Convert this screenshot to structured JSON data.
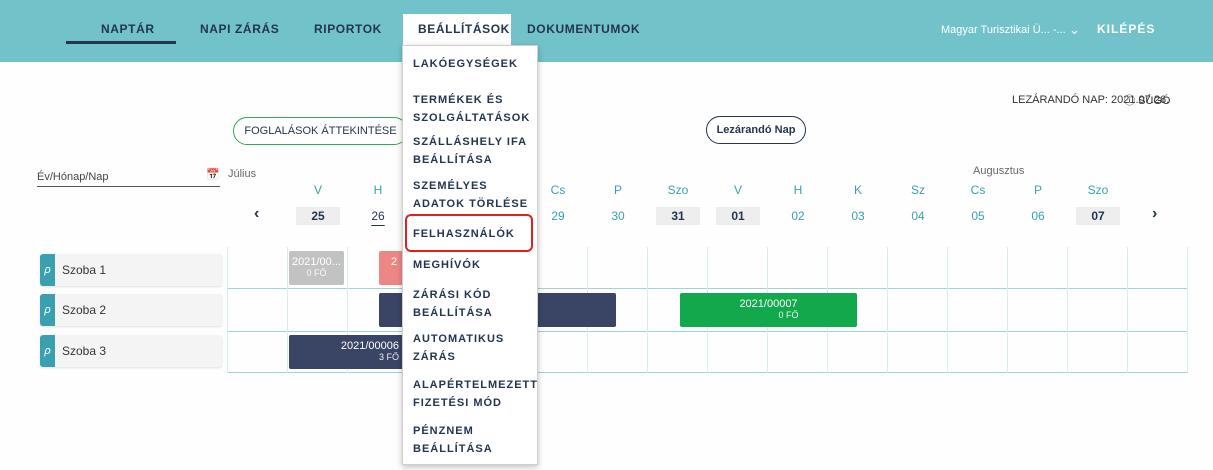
{
  "nav": {
    "items": [
      {
        "label": "NAPTÁR"
      },
      {
        "label": "NAPI ZÁRÁS"
      },
      {
        "label": "RIPORTOK"
      },
      {
        "label": "BEÁLLÍTÁSOK"
      },
      {
        "label": "DOKUMENTUMOK"
      }
    ],
    "user_label": "Magyar Turisztikai Ü... -...",
    "logout_label": "KILÉPÉS"
  },
  "header": {
    "closing_day_label": "LEZÁRANDÓ NAP: 2021.07.26.",
    "help_label": "SÚGÓ"
  },
  "buttons": {
    "overview_label": "FOGLALÁSOK ÁTTEKINTÉSE",
    "lezarando_label": "Lezárandó Nap"
  },
  "date_picker": {
    "placeholder": "Év/Hónap/Nap"
  },
  "calendar": {
    "months": [
      "Július",
      "Augusztus"
    ],
    "days": [
      {
        "name": "V",
        "num": "25",
        "weekend": true
      },
      {
        "name": "H",
        "num": "26",
        "today": true
      },
      {
        "name": "",
        "num": ""
      },
      {
        "name": "",
        "num": ""
      },
      {
        "name": "Cs",
        "num": "29"
      },
      {
        "name": "P",
        "num": "30"
      },
      {
        "name": "Szo",
        "num": "31",
        "weekend": true
      },
      {
        "name": "V",
        "num": "01",
        "weekend": true
      },
      {
        "name": "H",
        "num": "02"
      },
      {
        "name": "K",
        "num": "03"
      },
      {
        "name": "Sz",
        "num": "04"
      },
      {
        "name": "Cs",
        "num": "05"
      },
      {
        "name": "P",
        "num": "06"
      },
      {
        "name": "Szo",
        "num": "07",
        "weekend": true
      }
    ],
    "prev_icon": "‹",
    "next_icon": "›"
  },
  "rooms": [
    {
      "name": "Szoba 1"
    },
    {
      "name": "Szoba 2"
    },
    {
      "name": "Szoba 3"
    }
  ],
  "bookings": [
    {
      "id": "2021/00...",
      "guests": "0 FŐ",
      "color": "#c2c2c2"
    },
    {
      "id": "2",
      "guests": "",
      "color": "#ef8686"
    },
    {
      "id": "",
      "guests": "",
      "color": "#3a4565"
    },
    {
      "id": "2021/00007",
      "guests": "0 FŐ",
      "color": "#12a84c"
    },
    {
      "id": "2021/00006",
      "guests": "3 FŐ",
      "color": "#3a4565"
    }
  ],
  "dropdown": {
    "items": [
      {
        "label": "LAKÓEGYSÉGEK"
      },
      {
        "label": "TERMÉKEK ÉS SZOLGÁLTATÁSOK"
      },
      {
        "label": "SZÁLLÁSHELY IFA BEÁLLÍTÁSA"
      },
      {
        "label": "SZEMÉLYES ADATOK TÖRLÉSE"
      },
      {
        "label": "FELHASZNÁLÓK"
      },
      {
        "label": "MEGHÍVÓK"
      },
      {
        "label": "ZÁRÁSI KÓD BEÁLLÍTÁSA"
      },
      {
        "label": "AUTOMATIKUS ZÁRÁS"
      },
      {
        "label": "ALAPÉRTELMEZETT FIZETÉSI MÓD"
      },
      {
        "label": "PÉNZNEM BEÁLLÍTÁSA"
      }
    ]
  },
  "colors": {
    "topbar": "#72c3c9",
    "navy": "#23354f",
    "accent": "#3aa0b0",
    "highlight": "#e02020"
  }
}
